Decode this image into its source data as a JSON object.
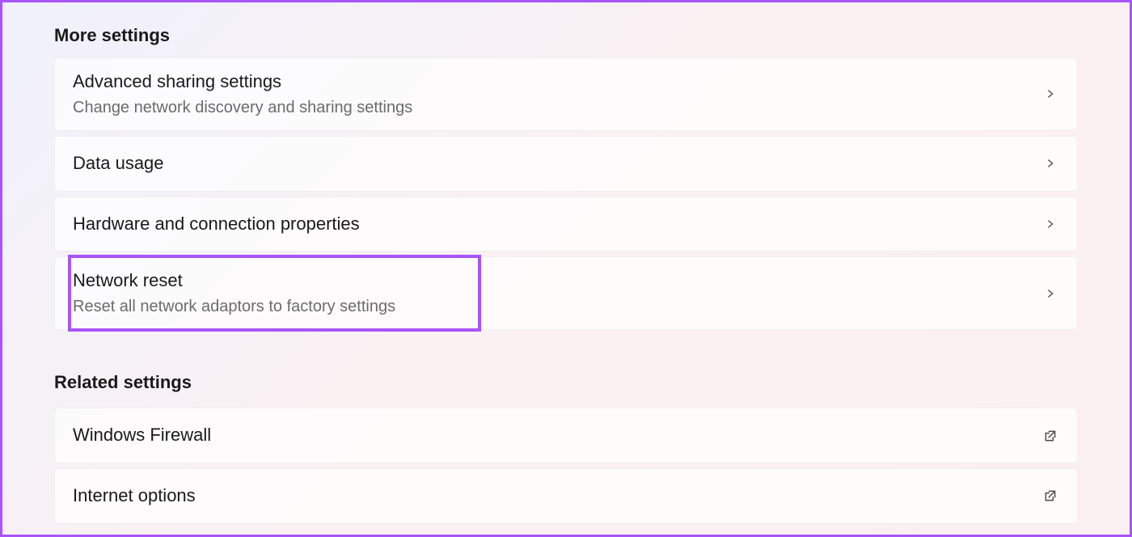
{
  "sections": {
    "more_settings": {
      "header": "More settings",
      "items": [
        {
          "title": "Advanced sharing settings",
          "subtitle": "Change network discovery and sharing settings",
          "icon": "chevron"
        },
        {
          "title": "Data usage",
          "subtitle": "",
          "icon": "chevron"
        },
        {
          "title": "Hardware and connection properties",
          "subtitle": "",
          "icon": "chevron"
        },
        {
          "title": "Network reset",
          "subtitle": "Reset all network adaptors to factory settings",
          "icon": "chevron",
          "highlighted": true
        }
      ]
    },
    "related_settings": {
      "header": "Related settings",
      "items": [
        {
          "title": "Windows Firewall",
          "subtitle": "",
          "icon": "external"
        },
        {
          "title": "Internet options",
          "subtitle": "",
          "icon": "external"
        }
      ]
    }
  }
}
